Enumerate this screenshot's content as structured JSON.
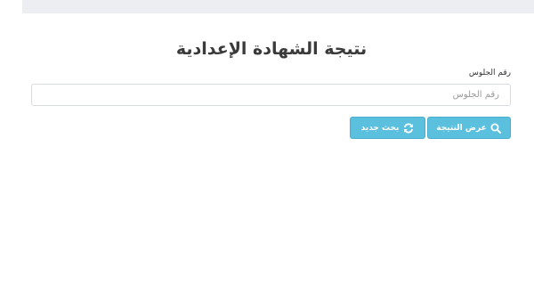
{
  "page": {
    "title": "نتيجة الشهادة الإعدادية"
  },
  "form": {
    "seat_label": "رقم الجلوس",
    "seat_placeholder": "رقم الجلوس",
    "seat_value": ""
  },
  "buttons": {
    "show_result": {
      "label": "عرض النتيجة",
      "icon": "search-icon"
    },
    "new_search": {
      "label": "بحث جديد",
      "icon": "refresh-icon"
    }
  },
  "colors": {
    "button_bg": "#5bc0de",
    "top_bar": "#eceef1",
    "title_text": "#3a3a3a"
  }
}
